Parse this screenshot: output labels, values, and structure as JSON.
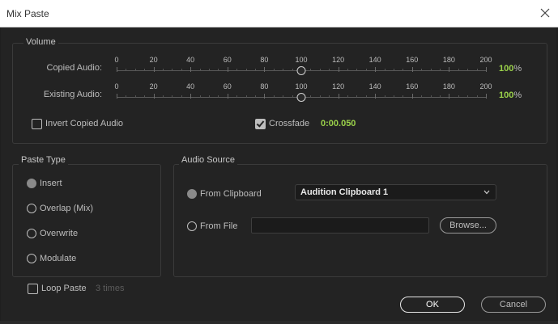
{
  "window": {
    "title": "Mix Paste"
  },
  "volume": {
    "group_label": "Volume",
    "tick_labels": [
      "0",
      "20",
      "40",
      "60",
      "80",
      "100",
      "120",
      "140",
      "160",
      "180",
      "200"
    ],
    "copied": {
      "label": "Copied Audio:",
      "value": "100",
      "unit": "%",
      "level": 100
    },
    "existing": {
      "label": "Existing Audio:",
      "value": "100",
      "unit": "%",
      "level": 100
    },
    "invert": {
      "label": "Invert Copied Audio",
      "checked": false
    },
    "crossfade": {
      "label": "Crossfade",
      "checked": true,
      "value": "0:00.050"
    }
  },
  "paste_type": {
    "group_label": "Paste Type",
    "options": [
      {
        "label": "Insert",
        "selected": true
      },
      {
        "label": "Overlap (Mix)",
        "selected": false
      },
      {
        "label": "Overwrite",
        "selected": false
      },
      {
        "label": "Modulate",
        "selected": false
      }
    ]
  },
  "audio_source": {
    "group_label": "Audio Source",
    "clipboard": {
      "label": "From Clipboard",
      "selected": true,
      "dropdown_value": "Audition Clipboard 1"
    },
    "file": {
      "label": "From File",
      "selected": false,
      "path": "",
      "browse_label": "Browse..."
    }
  },
  "loop": {
    "label": "Loop Paste",
    "checked": false,
    "times": "3 times"
  },
  "buttons": {
    "ok": "OK",
    "cancel": "Cancel"
  }
}
